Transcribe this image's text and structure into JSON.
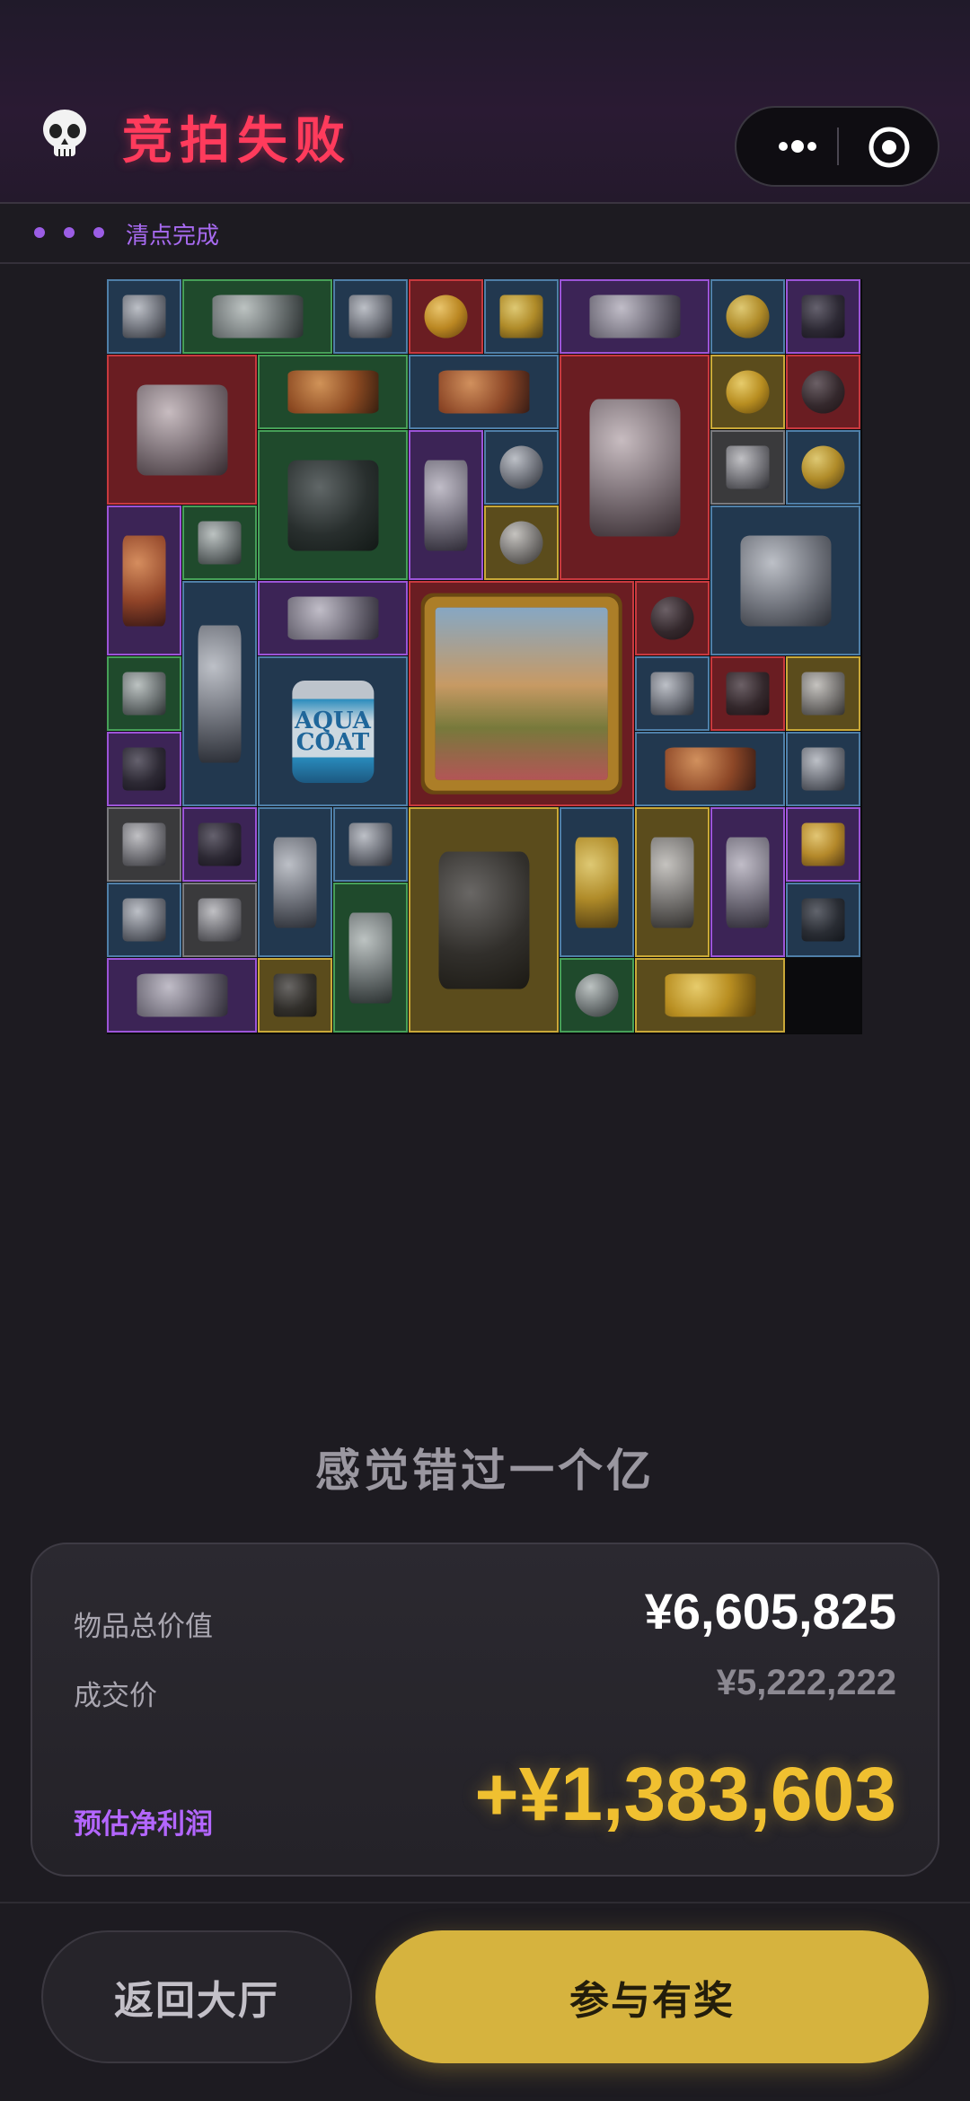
{
  "header": {
    "icon": "skull-icon",
    "title": "竞拍失败",
    "title_color": "#ff3b5c",
    "capsule": {
      "more_icon": "more-dots-icon",
      "target_icon": "target-icon"
    }
  },
  "status": {
    "text": "清点完成",
    "accent": "#9b5de5"
  },
  "grid": {
    "items": [
      {
        "item": "silver-ingot-icon",
        "rarity": "blue"
      },
      {
        "item": "old-map-icon",
        "rarity": "green"
      },
      {
        "item": "ration-pack-icon",
        "rarity": "blue"
      },
      {
        "item": "pocket-watch-icon",
        "rarity": "red"
      },
      {
        "item": "warning-sign-icon",
        "rarity": "blue"
      },
      {
        "item": "sound-card-icon",
        "rarity": "purple"
      },
      {
        "item": "coin-icon",
        "rarity": "blue"
      },
      {
        "item": "walkie-talkie-icon",
        "rarity": "purple"
      },
      {
        "item": "respirator-tank-icon",
        "rarity": "red"
      },
      {
        "item": "wooden-plank-icon",
        "rarity": "green"
      },
      {
        "item": "power-drill-icon",
        "rarity": "blue"
      },
      {
        "item": "medical-robot-icon",
        "rarity": "red"
      },
      {
        "item": "coin-icon",
        "rarity": "gold"
      },
      {
        "item": "bracelet-icon",
        "rarity": "red"
      },
      {
        "item": "power-supply-icon",
        "rarity": "green"
      },
      {
        "item": "pliers-icon",
        "rarity": "purple"
      },
      {
        "item": "disc-icon",
        "rarity": "blue"
      },
      {
        "item": "documents-icon",
        "rarity": "gray"
      },
      {
        "item": "coin-icon",
        "rarity": "blue"
      },
      {
        "item": "lantern-icon",
        "rarity": "purple"
      },
      {
        "item": "pen-icon",
        "rarity": "green"
      },
      {
        "item": "pearls-icon",
        "rarity": "gold"
      },
      {
        "item": "camp-stove-icon",
        "rarity": "blue"
      },
      {
        "item": "water-bottle-icon",
        "rarity": "green"
      },
      {
        "item": "smart-meter-icon",
        "rarity": "blue"
      },
      {
        "item": "slate-icon",
        "rarity": "purple"
      },
      {
        "item": "oil-painting-icon",
        "rarity": "red"
      },
      {
        "item": "bracelet-icon",
        "rarity": "red"
      },
      {
        "item": "paint-can-icon",
        "rarity": "blue",
        "label": "AQUA COAT"
      },
      {
        "item": "silver-ingot-icon",
        "rarity": "blue"
      },
      {
        "item": "camera-module-icon",
        "rarity": "red"
      },
      {
        "item": "circuit-board-icon",
        "rarity": "gold"
      },
      {
        "item": "walkie-talkie-icon",
        "rarity": "purple"
      },
      {
        "item": "smoking-pipe-icon",
        "rarity": "blue"
      },
      {
        "item": "water-bottle-icon",
        "rarity": "blue"
      },
      {
        "item": "playing-card-icon",
        "rarity": "gray"
      },
      {
        "item": "binoculars-icon",
        "rarity": "purple"
      },
      {
        "item": "ballerina-statue-icon",
        "rarity": "blue"
      },
      {
        "item": "cable-reel-icon",
        "rarity": "blue"
      },
      {
        "item": "tough-case-icon",
        "rarity": "gold"
      },
      {
        "item": "ammo-box-icon",
        "rarity": "blue"
      },
      {
        "item": "banknotes-icon",
        "rarity": "gold"
      },
      {
        "item": "torch-statue-icon",
        "rarity": "purple"
      },
      {
        "item": "soda-can-icon",
        "rarity": "purple"
      },
      {
        "item": "mp3-player-icon",
        "rarity": "blue"
      },
      {
        "item": "playing-card-icon",
        "rarity": "gray"
      },
      {
        "item": "tablet-icon",
        "rarity": "green"
      },
      {
        "item": "canned-food-icon",
        "rarity": "blue"
      },
      {
        "item": "sound-card-icon",
        "rarity": "purple"
      },
      {
        "item": "smartphone-icon",
        "rarity": "gold"
      },
      {
        "item": "faucet-valve-icon",
        "rarity": "green"
      },
      {
        "item": "laurel-wreath-icon",
        "rarity": "gold"
      },
      {
        "item": "",
        "rarity": "empty"
      }
    ]
  },
  "message": "感觉错过一个亿",
  "summary": {
    "total_label": "物品总价值",
    "total_value": "¥6,605,825",
    "price_label": "成交价",
    "price_value": "¥5,222,222",
    "profit_label": "预估净利润",
    "profit_value": "+¥1,383,603",
    "profit_color": "#f0c030"
  },
  "buttons": {
    "back": "返回大厅",
    "join": "参与有奖"
  }
}
